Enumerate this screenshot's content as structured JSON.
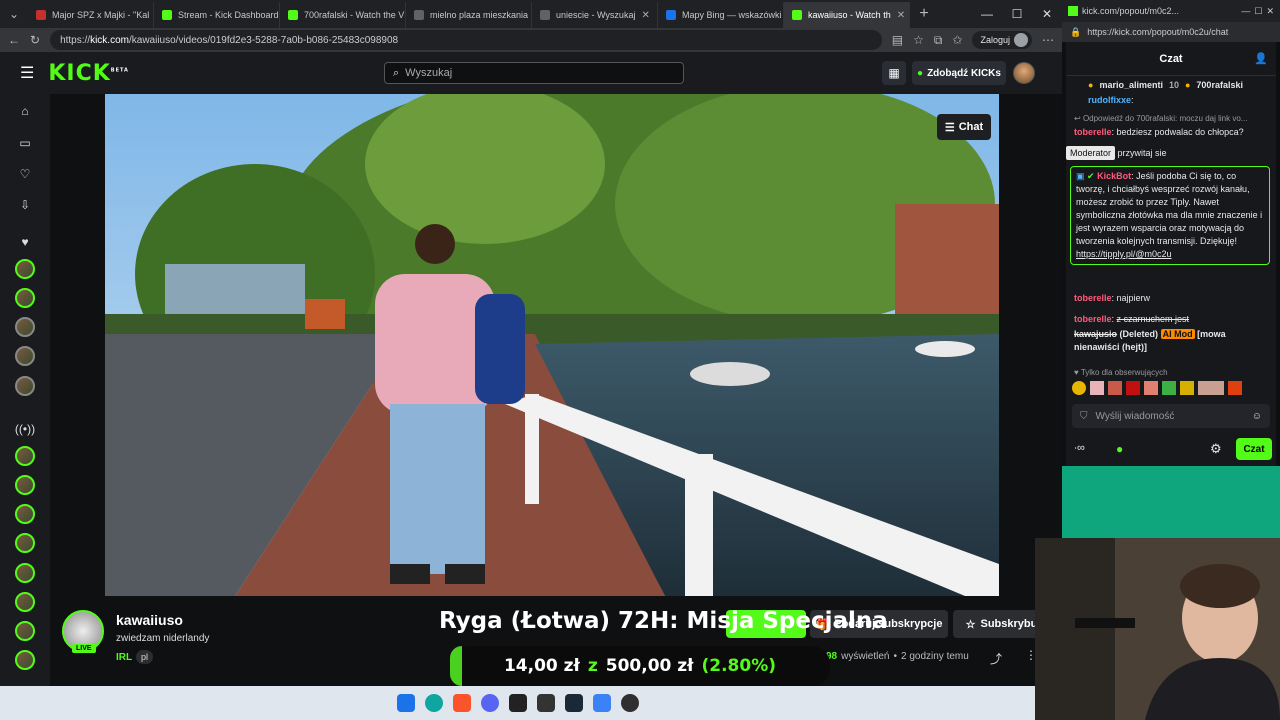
{
  "browser": {
    "tabs": [
      {
        "label": "Major SPZ x Majki - \"Kal",
        "color": "#c4302b"
      },
      {
        "label": "Stream - Kick Dashboard",
        "color": "#53fc18"
      },
      {
        "label": "700rafalski - Watch the V",
        "color": "#53fc18"
      },
      {
        "label": "mielno plaza mieszkania",
        "color": "#5f6368"
      },
      {
        "label": "uniescie - Wyszukaj",
        "color": "#5f6368"
      },
      {
        "label": "Mapy Bing — wskazówki",
        "color": "#1a73e8"
      },
      {
        "label": "kawaiiuso - Watch th",
        "color": "#53fc18"
      }
    ],
    "url_host": "kick.com",
    "url_path": "/kawaiiuso/videos/019fd2e3-5288-7a0b-b086-25483c098908",
    "url_prefix": "https://",
    "login_label": "Zaloguj"
  },
  "kick": {
    "logo": "KICK",
    "logo_sup": "BETA",
    "search_placeholder": "Wyszukaj",
    "get_kicks": "Zdobądź KICKs",
    "chat_button": "Chat"
  },
  "channel": {
    "name": "kawaiiuso",
    "title": "zwiedzam niderlandy",
    "live_badge": "LIVE",
    "category": "IRL",
    "language": "pl",
    "viewers": "98",
    "viewers_label": "wyświetleń",
    "time_ago": "2 godziny temu",
    "gift_sub": "Podaruj subskrypcje",
    "subscribe": "Subskrybuj"
  },
  "overlay": {
    "headline_a": "Ryga (Łotwa) 72H: Misja ",
    "headline_b": "Specjalna",
    "goal_current": "14,00 zł",
    "goal_sep": "z",
    "goal_target": "500,00 zł",
    "goal_pct": "(2.80%)",
    "goal_progress": 0.028
  },
  "popout": {
    "tab_label": "kick.com/popout/m0c2...",
    "url": "https://kick.com/popout/m0c2u/chat",
    "header": "Czat",
    "pinned_user1": "mario_alimenti",
    "pinned_user1_count": "10",
    "pinned_user2": "700rafalski",
    "moderator_tooltip": "Moderator",
    "messages": [
      {
        "user": "rudolfixxe",
        "text": ""
      },
      {
        "user": "",
        "text": "Odpowiedź do 700rafalski: moczu daj link vo..."
      },
      {
        "user": "toberelle",
        "text": "bedziesz podwalac do chłopca?"
      },
      {
        "user": "",
        "text": "przywitaj sie"
      },
      {
        "user": "KickBot",
        "text": "Jeśli podoba Ci się to, co tworzę, i chciałbyś wesprzeć rozwój kanału, możesz zrobić to przez Tiply. Nawet symboliczna złotówka ma dla mnie znaczenie i jest wyrazem wsparcia oraz motywacją do tworzenia kolejnych transmisji. Dziękuję!",
        "link": "https://tipply.pl/@m0c2u"
      },
      {
        "user": "toberelle",
        "text": "najpierw"
      },
      {
        "user": "toberelle",
        "text": "z czarnuchem jest"
      },
      {
        "user": "kawajusio",
        "text": "(Deleted)",
        "badge": "AI Mod",
        "reason": "[mowa nienawiści (hejt)]"
      }
    ],
    "followers_only": "Tylko dla obserwujących",
    "input_placeholder": "Wyślij wiadomość",
    "send_label": "Czat"
  },
  "colors": {
    "kick_green": "#53fc18",
    "bg": "#0f1012",
    "panel": "#191b1f"
  }
}
